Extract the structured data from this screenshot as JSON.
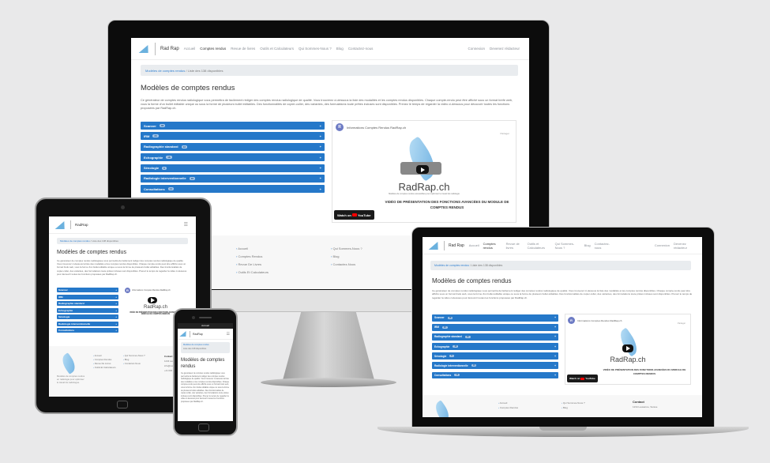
{
  "site": {
    "brand": "Rad Rap",
    "brand_short": "RadRap",
    "nav": [
      "Accueil",
      "Comptes rendus",
      "Revue de livres",
      "Outils et Calculateurs",
      "Qui Sommes-Nous ?",
      "Blog",
      "Contactez-nous"
    ],
    "nav_right": [
      "Connexion",
      "Inscription",
      "Devenir un rédacteur",
      "Devenez rédacteur"
    ],
    "breadcrumb_home": "Modèles de comptes rendus",
    "breadcrumb_current": "Liste des 138 disponibles",
    "title": "Modèles de comptes rendus",
    "intro": "Ce générateur de comptes rendus radiologique vous permettra de facilement rédiger des comptes rendus radiologique de qualité. Vous trouverez ci-dessous la liste des modalités et les comptes rendus disponibles. Chaque compte-rendu peut être affiché sous un format brefe web, vous la forme d'un bullet éditable unique ou sous la forme de plusieurs bullet éditables. Des fonctionnalités de copier-coller, des variantes, des formulations toute prêtes incluses sont disponibles. Prenez le temps de regarder la vidéo ci-dessous pour découvrir toutes les fonctions proposées par RadRap.ch.",
    "categories": [
      {
        "label": "Scanner",
        "count": "48"
      },
      {
        "label": "IRM",
        "count": "23"
      },
      {
        "label": "Radiographie standard",
        "count": "13"
      },
      {
        "label": "Echographie",
        "count": "18"
      },
      {
        "label": "Sénologie",
        "count": "6"
      },
      {
        "label": "Radiologie interventionnelle",
        "count": "16"
      },
      {
        "label": "Consultations",
        "count": "14"
      }
    ],
    "video": {
      "avatar": "R",
      "channel_title": "Informations Comptes Rendus RadRap.ch",
      "share": "Partager",
      "brand": "RadRap.ch",
      "caption_small": "Modèles de comptes rendus accessibles pour optimiser le travail de radiologie",
      "caption": "VIDÉO DE PRÉSENTATION DES FONCTIONS AVANCÉES DU MODULE DE COMPTES RENDUS",
      "watch_on": "Watch on",
      "youtube": "YouTube"
    },
    "footer_col1": [
      "Accueil",
      "Comptes Rendus",
      "Revue De Livres",
      "Outils Et Calculateurs"
    ],
    "footer_col2": [
      "Qui Sommes-Nous ?",
      "Blog",
      "Contactez-Nous"
    ],
    "contact_title": "Contact",
    "contact_lines": [
      "1234 Lausanne, Suisse",
      "info@radrap.ch",
      "+41 000 00 00"
    ],
    "tagline": "Modèles de comptes rendus en radiologie pour optimiser le travail du radiologue.",
    "tab_label": "Accueil",
    "copyright": "Radrap.ch"
  }
}
